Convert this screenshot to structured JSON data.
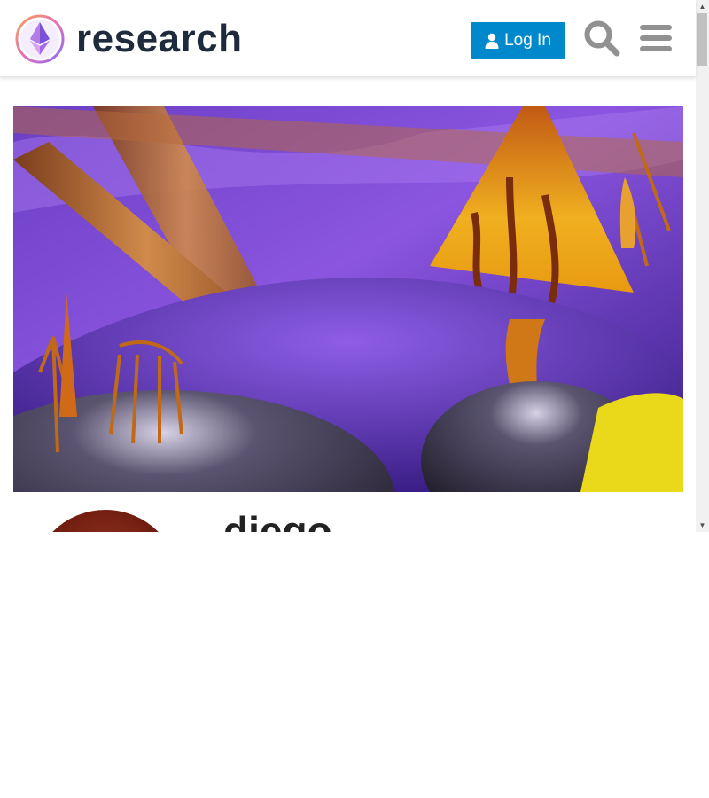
{
  "header": {
    "logo_text": "research",
    "login_label": "Log In"
  },
  "icons": {
    "logo": "ethereum-logo-icon",
    "user": "user-icon",
    "search": "search-icon",
    "menu": "hamburger-menu-icon"
  },
  "profile": {
    "username": "diego"
  },
  "colors": {
    "accent": "#0088cc",
    "text": "#222222"
  }
}
